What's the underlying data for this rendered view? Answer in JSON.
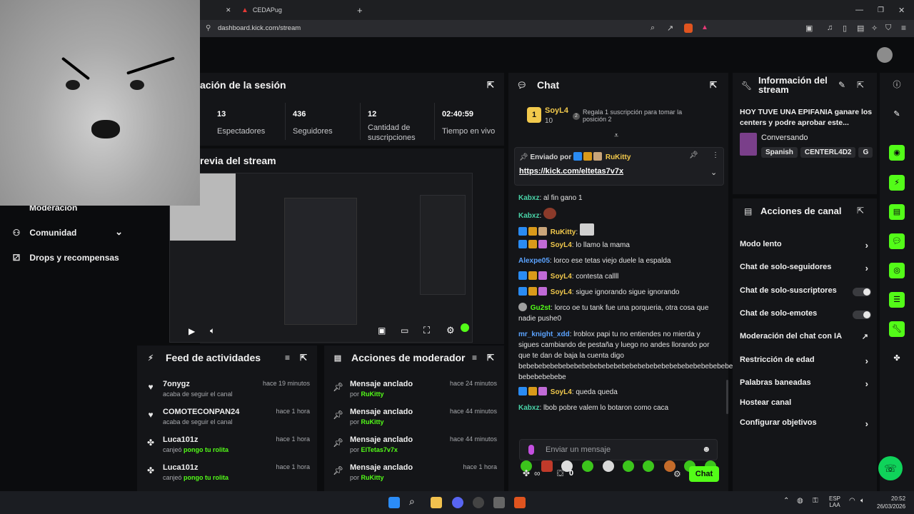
{
  "browser": {
    "tabs": [
      {
        "label": ""
      },
      {
        "label": "CEDAPug"
      }
    ],
    "url": "dashboard.kick.com/stream"
  },
  "sidebar": {
    "items": [
      {
        "label": "Moderación"
      },
      {
        "label": "Comunidad"
      },
      {
        "label": "Drops y recompensas"
      }
    ]
  },
  "session": {
    "title": "ación de la sesión",
    "stats": [
      {
        "value": "13",
        "label": "Espectadores"
      },
      {
        "value": "436",
        "label": "Seguidores"
      },
      {
        "value": "12",
        "label": "Cantidad de suscripciones"
      },
      {
        "value": "02:40:59",
        "label": "Tiempo en vivo"
      }
    ]
  },
  "preview": {
    "title": "revia del stream"
  },
  "feed": {
    "title": "Feed de actividades",
    "items": [
      {
        "name": "7onygz",
        "desc": "acaba de seguir el canal",
        "desc_highlight": "",
        "time": "hace 19 minutos",
        "icon": "heart-icon"
      },
      {
        "name": "COMOTECONPAN24",
        "desc": "acaba de seguir el canal",
        "desc_highlight": "",
        "time": "hace 1 hora",
        "icon": "heart-icon"
      },
      {
        "name": "Luca101z",
        "desc": "canjeó",
        "desc_highlight": "pongo tu rolita",
        "time": "hace 1 hora",
        "icon": "redeem-icon"
      },
      {
        "name": "Luca101z",
        "desc": "canjeó",
        "desc_highlight": "pongo tu rolita",
        "time": "hace 1 hora",
        "icon": "redeem-icon"
      }
    ]
  },
  "modactions": {
    "title": "Acciones de moderador",
    "items": [
      {
        "name": "Mensaje anclado",
        "by": "por",
        "user": "RuKitty",
        "time": "hace 24 minutos"
      },
      {
        "name": "Mensaje anclado",
        "by": "por",
        "user": "RuKitty",
        "time": "hace 44 minutos"
      },
      {
        "name": "Mensaje anclado",
        "by": "por",
        "user": "ElTetas7v7x",
        "time": "hace 44 minutos"
      },
      {
        "name": "Mensaje anclado",
        "by": "por",
        "user": "RuKitty",
        "time": "hace 1 hora"
      }
    ]
  },
  "chat": {
    "title": "Chat",
    "leader": {
      "name": "SoyL4",
      "count": "10",
      "rank": "2",
      "promo": "Regala 1 suscripción para tomar la posición 2"
    },
    "pinned": {
      "label": "Enviado por",
      "user": "RuKitty",
      "link": "https://kick.com/eltetas7v7x"
    },
    "messages": [
      {
        "user": "Kabxz",
        "text": "al fin gano 1",
        "color": "green"
      },
      {
        "user": "Kabxz",
        "text": "",
        "color": "green"
      },
      {
        "user": "RuKitty",
        "text": "",
        "color": "yellow"
      },
      {
        "user": "SoyL4",
        "text": "lo llamo la mama",
        "color": "yellow"
      },
      {
        "user": "Alexpe05",
        "text": "lorco ese tetas viejo duele la espalda",
        "color": "blue"
      },
      {
        "user": "SoyL4",
        "text": "contesta callll",
        "color": "yellow"
      },
      {
        "user": "SoyL4",
        "text": "sigue ignorando sigue ignorando",
        "color": "yellow"
      },
      {
        "user": "Gu2st",
        "text": "lorco oe tu tank fue una porqueria, otra cosa que nadie pushe0",
        "color": "green"
      },
      {
        "user": "mr_knight_xdd",
        "text": "lroblox papi tu no entiendes no mierda y sigues cambiando de pestaña y luego no andes llorando por que te dan de baja la cuenta digo bebebebebebebebebebebebebebebebebebebebebebebebebebebebe bebebebebebe",
        "color": "blue"
      },
      {
        "user": "SoyL4",
        "text": "queda queda",
        "color": "yellow"
      },
      {
        "user": "Kabxz",
        "text": "lbob pobre valem lo botaron como caca",
        "color": "green"
      }
    ],
    "input_placeholder": "Enviar un mensaje",
    "bottom_count": "0",
    "send_label": "Chat"
  },
  "info": {
    "title": "Información del stream",
    "stream_title": "HOY TUVE UNA EPIFANIA ganare los centers y podre aprobar este...",
    "category": "Conversando",
    "tags": [
      "Spanish",
      "CENTERL4D2"
    ]
  },
  "channel": {
    "title": "Acciones de canal",
    "items": [
      {
        "label": "Modo lento",
        "type": "chevron"
      },
      {
        "label": "Chat de solo-seguidores",
        "type": "chevron"
      },
      {
        "label": "Chat de solo-suscriptores",
        "type": "toggle"
      },
      {
        "label": "Chat de solo-emotes",
        "type": "toggle"
      },
      {
        "label": "Moderación del chat con IA",
        "type": "external"
      },
      {
        "label": "Restricción de edad",
        "type": "chevron"
      },
      {
        "label": "Palabras baneadas",
        "type": "chevron"
      },
      {
        "label": "Hostear canal",
        "type": "none"
      },
      {
        "label": "Configurar objetivos",
        "type": "chevron"
      }
    ]
  },
  "taskbar": {
    "lang": "ESP",
    "region": "LAA",
    "time": "20:52",
    "date": "26/03/2026"
  },
  "colors": {
    "accent": "#53fc18",
    "panel": "#141518",
    "background": "#0b0c0e"
  }
}
